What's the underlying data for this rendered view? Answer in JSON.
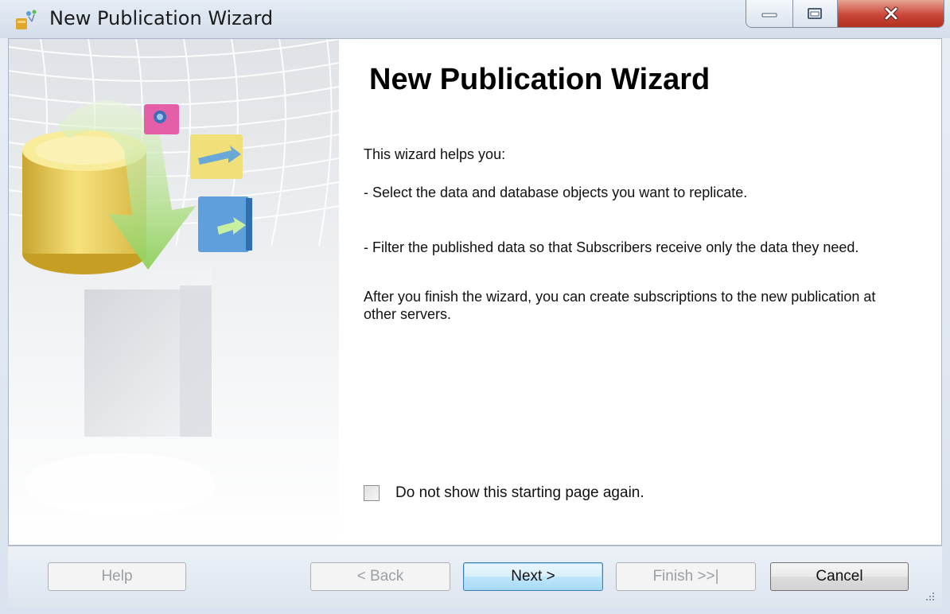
{
  "window": {
    "title": "New Publication Wizard",
    "icon": "wizard-app-icon"
  },
  "caption_buttons": {
    "minimize_icon": "minimize-icon",
    "maximize_icon": "maximize-icon",
    "close_icon": "close-icon",
    "close_color": "#c9473a"
  },
  "content": {
    "heading": "New Publication Wizard",
    "intro": "This wizard helps you:",
    "bullet1": "- Select the data and database objects you want to replicate.",
    "bullet2": "- Filter the published data so that Subscribers receive only the data they need.",
    "outro": "After you finish the wizard, you can create subscriptions to the new publication at other servers."
  },
  "option": {
    "checkbox_label": "Do not show this starting page again.",
    "checked": false
  },
  "buttons": {
    "help": "Help",
    "back": "< Back",
    "next": "Next >",
    "finish": "Finish >>|",
    "cancel": "Cancel"
  }
}
